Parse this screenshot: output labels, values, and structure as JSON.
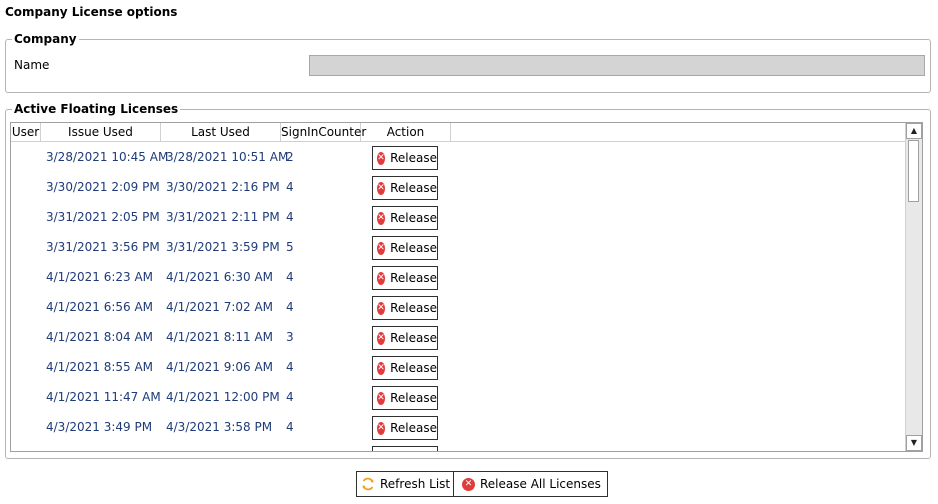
{
  "page": {
    "title": "Company License options"
  },
  "company": {
    "legend": "Company",
    "name_label": "Name",
    "name_value": ""
  },
  "licenses": {
    "legend": "Active Floating Licenses",
    "columns": [
      "User",
      "Issue Used",
      "Last Used",
      "SignInCounter",
      "Action"
    ],
    "release_label": "Release",
    "rows": [
      {
        "user": "",
        "issue": "3/28/2021 10:45 AM",
        "last": "3/28/2021 10:51 AM",
        "count": "2"
      },
      {
        "user": "",
        "issue": "3/30/2021 2:09 PM",
        "last": "3/30/2021 2:16 PM",
        "count": "4"
      },
      {
        "user": "",
        "issue": "3/31/2021 2:05 PM",
        "last": "3/31/2021 2:11 PM",
        "count": "4"
      },
      {
        "user": "",
        "issue": "3/31/2021 3:56 PM",
        "last": "3/31/2021 3:59 PM",
        "count": "5"
      },
      {
        "user": "",
        "issue": "4/1/2021 6:23 AM",
        "last": "4/1/2021 6:30 AM",
        "count": "4"
      },
      {
        "user": "",
        "issue": "4/1/2021 6:56 AM",
        "last": "4/1/2021 7:02 AM",
        "count": "4"
      },
      {
        "user": "",
        "issue": "4/1/2021 8:04 AM",
        "last": "4/1/2021 8:11 AM",
        "count": "3"
      },
      {
        "user": "",
        "issue": "4/1/2021 8:55 AM",
        "last": "4/1/2021 9:06 AM",
        "count": "4"
      },
      {
        "user": "",
        "issue": "4/1/2021 11:47 AM",
        "last": "4/1/2021 12:00 PM",
        "count": "4"
      },
      {
        "user": "",
        "issue": "4/3/2021 3:49 PM",
        "last": "4/3/2021 3:58 PM",
        "count": "4"
      },
      {
        "user": "",
        "issue": "",
        "last": "",
        "count": ""
      }
    ]
  },
  "buttons": {
    "refresh_label": "Refresh List",
    "release_all_label": "Release All Licenses"
  },
  "colors": {
    "cell_text": "#1f3b78",
    "release_icon": "#e23b3b",
    "refresh_icon": "#f0a020"
  }
}
